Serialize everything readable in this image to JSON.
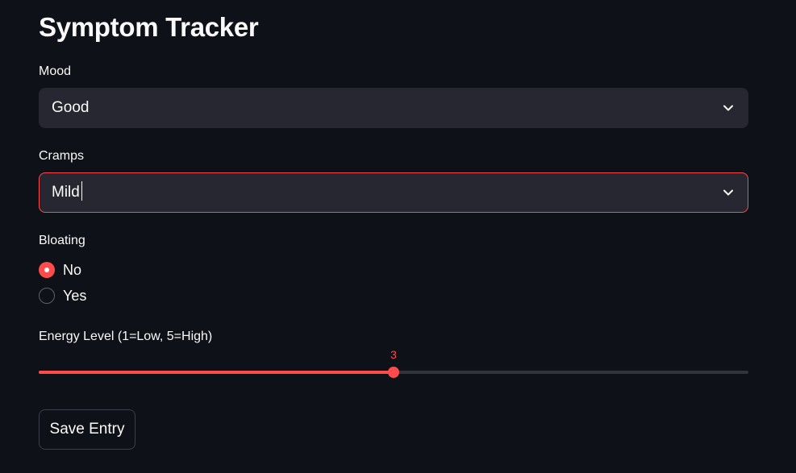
{
  "page": {
    "title": "Symptom Tracker"
  },
  "mood": {
    "label": "Mood",
    "selected": "Good",
    "icon": "chevron-down-icon"
  },
  "cramps": {
    "label": "Cramps",
    "selected": "Mild",
    "icon": "chevron-down-icon",
    "focused": true
  },
  "bloating": {
    "label": "Bloating",
    "options": [
      "No",
      "Yes"
    ],
    "selected": "No"
  },
  "energy": {
    "label": "Energy Level (1=Low, 5=High)",
    "min": 1,
    "max": 5,
    "value": 3,
    "value_text": "3"
  },
  "actions": {
    "save_label": "Save Entry"
  },
  "colors": {
    "background": "#0e1117",
    "accent": "#ff4b4b",
    "input_bg": "#262730",
    "text": "#fafafa"
  }
}
